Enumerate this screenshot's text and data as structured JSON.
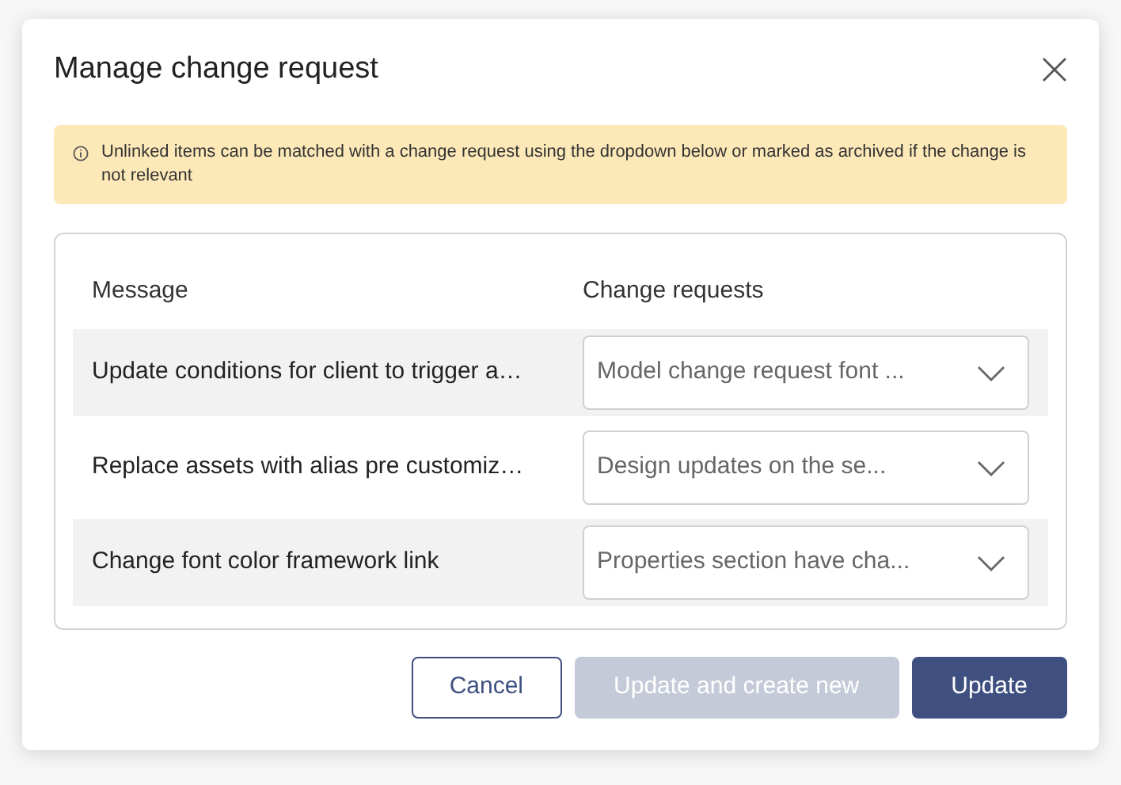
{
  "dialog": {
    "title": "Manage change request"
  },
  "alert": {
    "text": "Unlinked items can be matched with a change request using the dropdown below or marked as archived if the change is not relevant"
  },
  "table": {
    "columns": [
      "Message",
      "Change requests"
    ],
    "rows": [
      {
        "message": "Update conditions for client to trigger a…",
        "change_request": "Model change request font ..."
      },
      {
        "message": "Replace assets with alias pre customiz…",
        "change_request": "Design updates on the se..."
      },
      {
        "message": "Change font color framework link",
        "change_request": "Properties section have cha..."
      }
    ]
  },
  "buttons": [
    {
      "label": "Cancel",
      "kind": "secondary",
      "disabled": false
    },
    {
      "label": "Update and create new",
      "kind": "primary",
      "disabled": true
    },
    {
      "label": "Update",
      "kind": "primary",
      "disabled": false
    }
  ]
}
